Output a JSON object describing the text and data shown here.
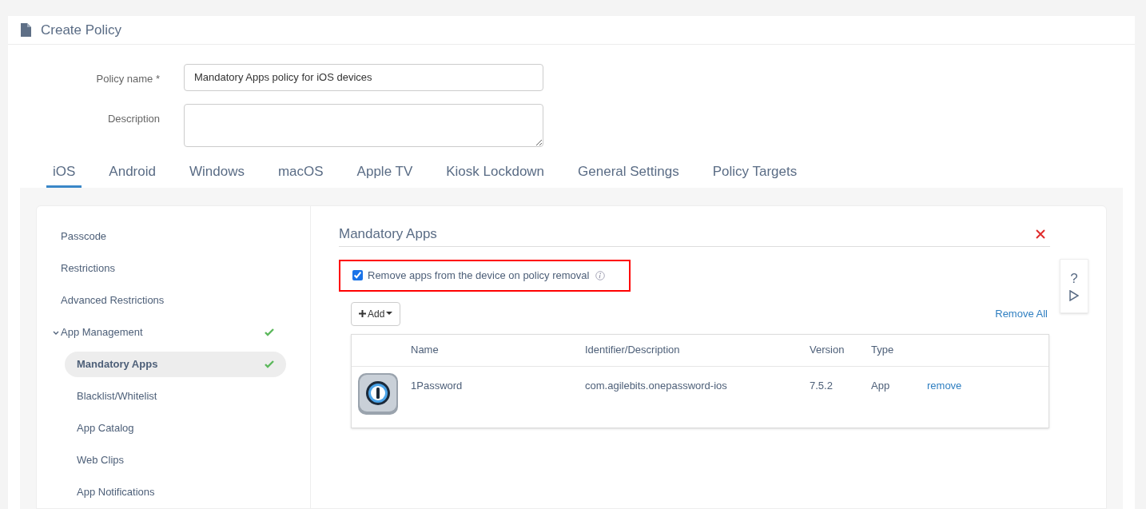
{
  "header": {
    "title": "Create Policy"
  },
  "form": {
    "fields": [
      {
        "label": "Policy name *",
        "value": "Mandatory Apps policy for iOS devices",
        "kind": "text"
      },
      {
        "label": "Description",
        "kind": "textarea"
      }
    ]
  },
  "tabs": [
    {
      "label": "iOS",
      "selected": true
    },
    {
      "label": "Android",
      "selected": false
    },
    {
      "label": "Windows",
      "selected": false
    },
    {
      "label": "macOS",
      "selected": false
    },
    {
      "label": "Apple TV",
      "selected": false
    },
    {
      "label": "Kiosk Lockdown",
      "selected": false
    },
    {
      "label": "General Settings",
      "selected": false
    },
    {
      "label": "Policy Targets",
      "selected": false
    }
  ],
  "sidebar": {
    "items": [
      {
        "label": "Passcode",
        "selected": false,
        "configured": false
      },
      {
        "label": "Restrictions",
        "selected": false,
        "configured": false
      },
      {
        "label": "Advanced Restrictions",
        "selected": false,
        "configured": false
      },
      {
        "label": "App Management",
        "selected": false,
        "configured": true,
        "expanded": true,
        "children": [
          {
            "label": "Mandatory Apps",
            "selected": true,
            "configured": true
          },
          {
            "label": "Blacklist/Whitelist",
            "selected": false,
            "configured": false
          },
          {
            "label": "App Catalog",
            "selected": false,
            "configured": false
          },
          {
            "label": "Web Clips",
            "selected": false,
            "configured": false
          },
          {
            "label": "App Notifications",
            "selected": false,
            "configured": false
          }
        ]
      }
    ]
  },
  "panel": {
    "title": "Mandatory Apps",
    "option": {
      "label": "Remove apps from the device on policy removal",
      "checked": true,
      "highlighted": true
    },
    "add_button": "Add",
    "remove_all": "Remove All",
    "table": {
      "columns": [
        "Name",
        "Identifier/Description",
        "Version",
        "Type"
      ],
      "rows": [
        {
          "name": "1Password",
          "identifier": "com.agilebits.onepassword-ios",
          "version": "7.5.2",
          "type": "App",
          "action": "remove"
        }
      ]
    }
  },
  "side_tools": {
    "help": "?"
  }
}
